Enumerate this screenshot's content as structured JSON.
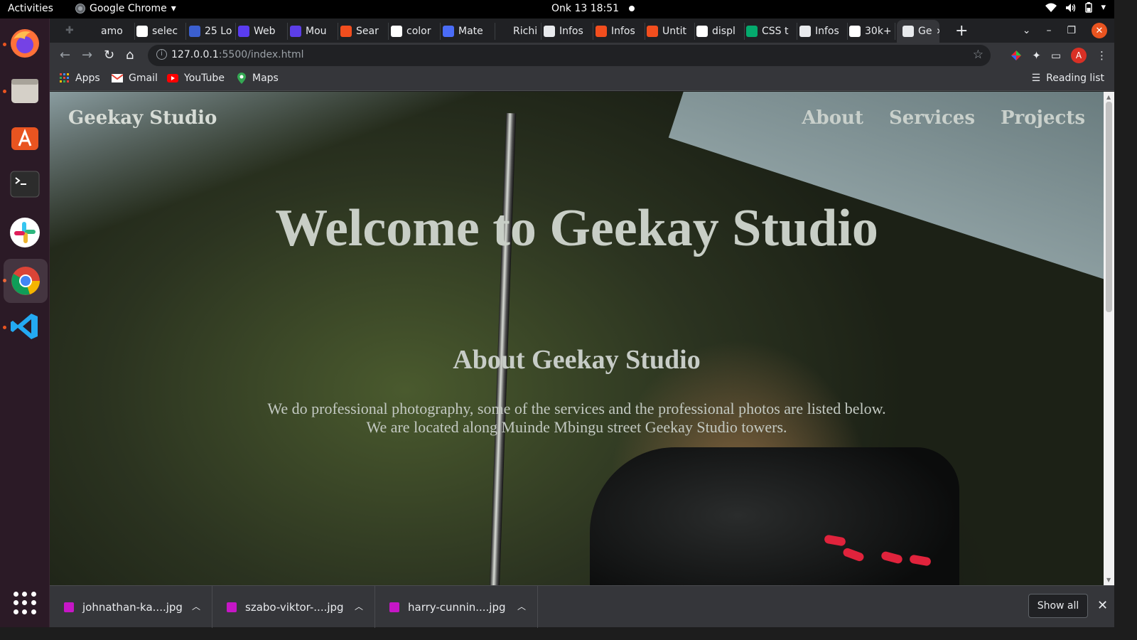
{
  "system": {
    "activities": "Activities",
    "app_name": "Google Chrome",
    "clock": "Onk 13  18:51"
  },
  "tabs": [
    {
      "label": "amo",
      "favicon": "github",
      "color": "#202124"
    },
    {
      "label": "selec",
      "favicon": "google",
      "color": "#ffffff"
    },
    {
      "label": "25 Lo",
      "favicon": "bo",
      "color": "#3b5fd0"
    },
    {
      "label": "Web",
      "favicon": "behance",
      "color": "#5a3cf0"
    },
    {
      "label": "Mou",
      "favicon": "n",
      "color": "#5c3ee8"
    },
    {
      "label": "Sear",
      "favicon": "figma",
      "color": "#f24e1e"
    },
    {
      "label": "color",
      "favicon": "google",
      "color": "#ffffff"
    },
    {
      "label": "Mate",
      "favicon": "material",
      "color": "#4a6cf7"
    },
    {
      "label": "Richi",
      "favicon": "github",
      "color": "#202124"
    },
    {
      "label": "Infos",
      "favicon": "globe",
      "color": "#e8eaed"
    },
    {
      "label": "Infos",
      "favicon": "figma",
      "color": "#f24e1e"
    },
    {
      "label": "Untit",
      "favicon": "figma",
      "color": "#f24e1e"
    },
    {
      "label": "displ",
      "favicon": "google",
      "color": "#ffffff"
    },
    {
      "label": "CSS t",
      "favicon": "w3",
      "color": "#04aa6d"
    },
    {
      "label": "Infos",
      "favicon": "globe",
      "color": "#e8eaed"
    },
    {
      "label": "30k+",
      "favicon": "unsplash",
      "color": "#ffffff"
    },
    {
      "label": "Ge",
      "favicon": "globe",
      "color": "#e8eaed",
      "active": true
    }
  ],
  "toolbar": {
    "url_host": "127.0.0.1",
    "url_rest": ":5500/index.html",
    "profile_initial": "A"
  },
  "bookmarks": {
    "items": [
      {
        "label": "Apps"
      },
      {
        "label": "Gmail"
      },
      {
        "label": "YouTube"
      },
      {
        "label": "Maps"
      }
    ],
    "reading_list": "Reading list"
  },
  "page": {
    "brand": "Geekay Studio",
    "nav": [
      "About",
      "Services",
      "Projects"
    ],
    "hero_title": "Welcome to Geekay Studio",
    "about_title": "About Geekay Studio",
    "about_line1": "We do professional photography, some of the services and the professional photos are listed below.",
    "about_line2": "We are located along Muinde Mbingu street Geekay Studio towers."
  },
  "downloads": {
    "files": [
      "johnathan-ka....jpg",
      "szabo-viktor-....jpg",
      "harry-cunnin....jpg"
    ],
    "show_all": "Show all"
  }
}
